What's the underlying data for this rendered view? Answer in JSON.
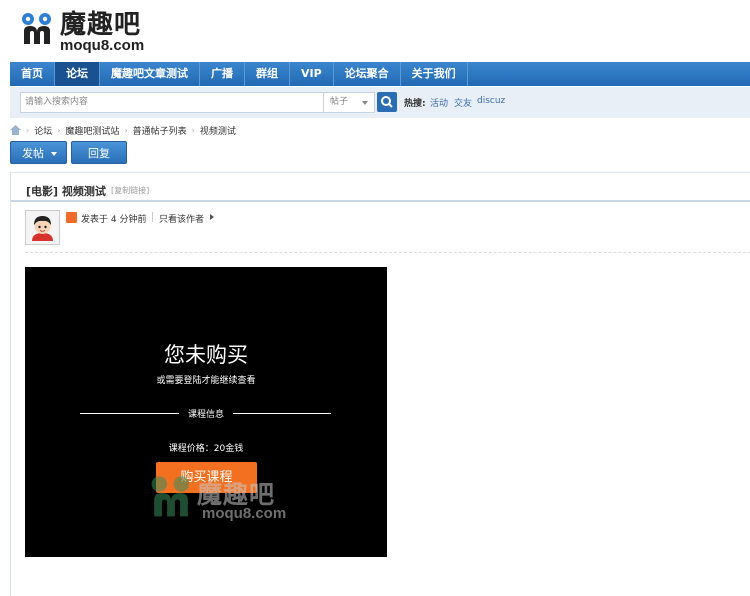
{
  "logo": {
    "cn": "魔趣吧",
    "en": "moqu8.com"
  },
  "nav": [
    {
      "label": "首页",
      "active": false
    },
    {
      "label": "论坛",
      "active": true
    },
    {
      "label": "魔趣吧文章测试",
      "active": false
    },
    {
      "label": "广播",
      "active": false
    },
    {
      "label": "群组",
      "active": false
    },
    {
      "label": "VIP",
      "active": false
    },
    {
      "label": "论坛聚合",
      "active": false
    },
    {
      "label": "关于我们",
      "active": false
    }
  ],
  "search": {
    "placeholder": "请输入搜索内容",
    "type": "帖子",
    "hot_label": "热搜:",
    "hot_links": [
      "活动",
      "交友",
      "discuz"
    ]
  },
  "breadcrumb": [
    "论坛",
    "魔趣吧测试站",
    "普通帖子列表",
    "视频测试"
  ],
  "buttons": {
    "post": "发帖",
    "reply": "回复"
  },
  "thread": {
    "title": "[电影] 视频测试",
    "copy_link": "[复制链接]",
    "posted_at": "发表于 4 分钟前",
    "only_author": "只看该作者"
  },
  "video": {
    "title": "您未购买",
    "subtitle": "或需要登陆才能继续查看",
    "info_label": "课程信息",
    "price": "课程价格：20金钱",
    "buy_button": "购买课程",
    "watermark_cn": "魔趣吧",
    "watermark_en": "moqu8.com"
  },
  "colors": {
    "nav_bg": "#2a6db5",
    "nav_active": "#1a5291",
    "buy": "#f37021",
    "author_icon": "#f06a2a"
  }
}
